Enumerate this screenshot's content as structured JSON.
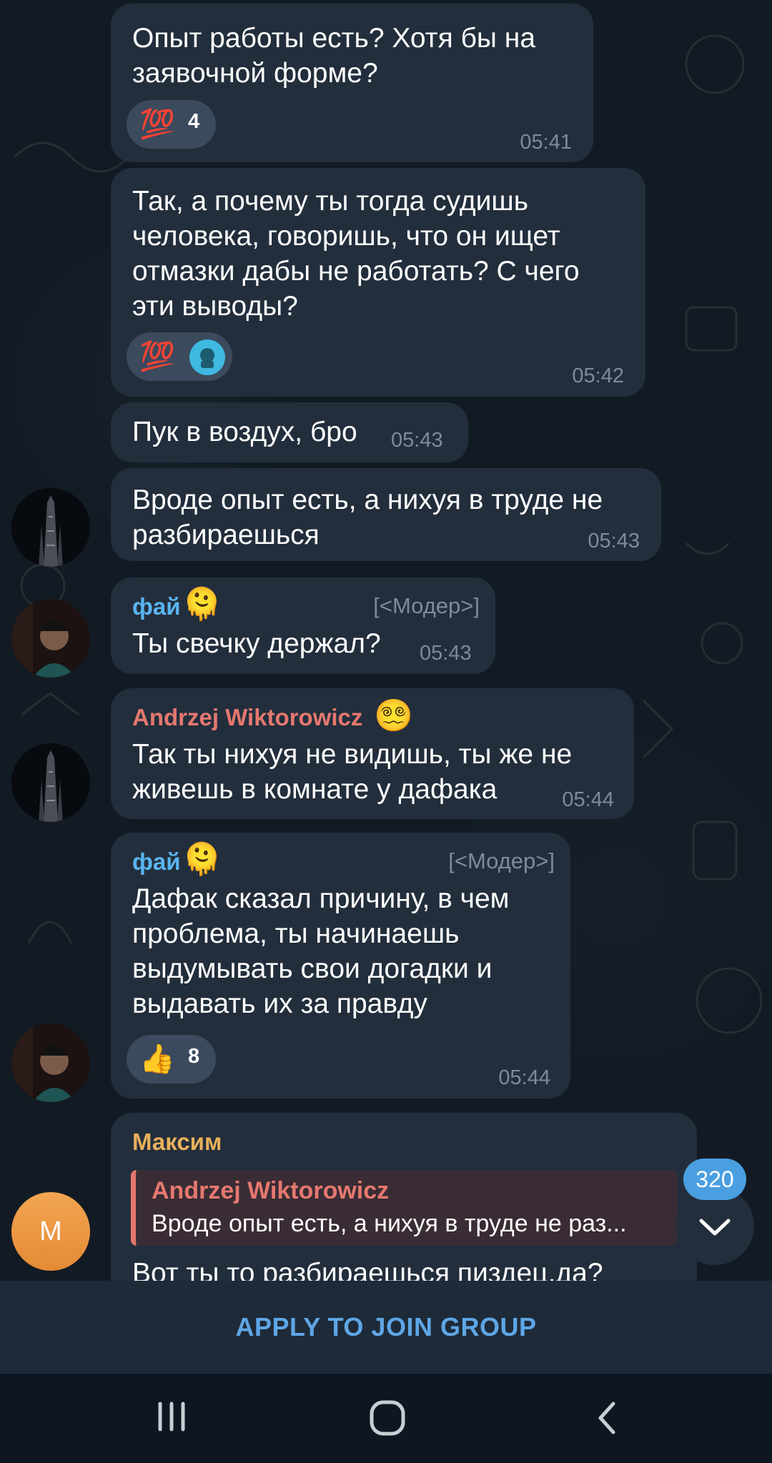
{
  "messages": [
    {
      "text": "Опыт работы есть? Хотя бы на\nзаявочной форме?",
      "time": "05:41",
      "reactions": [
        {
          "emoji": "💯",
          "count": "4"
        }
      ]
    },
    {
      "text": "Так, а почему ты тогда судишь\nчеловека, говоришь, что он ищет\nотмазки дабы не работать? С чего\nэти выводы?",
      "time": "05:42",
      "reactions": [
        {
          "emoji": "💯"
        }
      ]
    },
    {
      "text": "Пук в воздух, бро",
      "time": "05:43"
    },
    {
      "text": "Вроде опыт есть, а нихуя в труде не\nразбираешься",
      "time": "05:43"
    },
    {
      "sender": "фай",
      "tag": "[<Модер>]",
      "text": "Ты свечку держал?",
      "time": "05:43"
    },
    {
      "sender": "Andrzej Wiktorowicz",
      "text": "Так ты нихуя не видишь, ты же не\nживешь в комнате у дафака",
      "time": "05:44"
    },
    {
      "sender": "фай",
      "tag": "[<Модер>]",
      "text": "Дафак сказал причину, в чем\nпроблема, ты начинаешь\nвыдумывать свои догадки и\nвыдавать их за правду",
      "time": "05:44",
      "reactions": [
        {
          "emoji": "👍",
          "count": "8"
        }
      ]
    },
    {
      "sender": "Максим",
      "reply": {
        "name": "Andrzej Wiktorowicz",
        "text": "Вроде опыт есть, а нихуя в труде не раз..."
      },
      "text": "Вот ты то разбираешься пиздец,да?"
    }
  ],
  "avatars": {
    "maksim_initial": "M"
  },
  "scroll": {
    "unread_count": "320"
  },
  "footer": {
    "join_label": "APPLY TO JOIN GROUP"
  },
  "colors": {
    "bubble": "#232e3c",
    "fai": "#5ab4f0",
    "andrzej": "#e5786f",
    "maksim": "#e8b15c",
    "join": "#5ea6e6",
    "badge": "#4a9fe0"
  }
}
